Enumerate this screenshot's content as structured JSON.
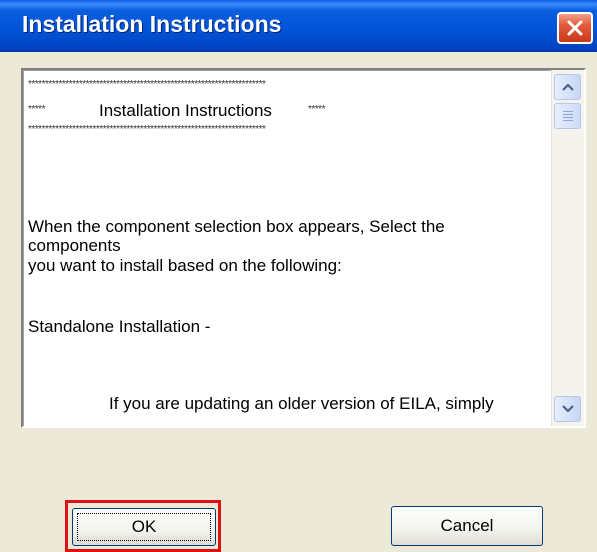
{
  "window": {
    "title": "Installation Instructions",
    "close_icon": "close-icon"
  },
  "textarea": {
    "lines": [
      "**********************************************************************",
      "*****",
      "Installation Instructions",
      "*****",
      "**********************************************************************",
      "When the component selection box appears, Select the",
      "components",
      "you want to install based on the following:",
      "Standalone Installation -",
      "If you are updating an older version of EILA, simply"
    ]
  },
  "scrollbar": {
    "up_icon": "chevron-up-icon",
    "down_icon": "chevron-down-icon",
    "thumb_icon": "scroll-thumb-grip-icon"
  },
  "buttons": {
    "ok_label": "OK",
    "cancel_label": "Cancel"
  },
  "colors": {
    "titlebar": "#0052d6",
    "close": "#e45a3c",
    "highlight": "#e01010",
    "dialog_bg": "#ece9d8"
  }
}
